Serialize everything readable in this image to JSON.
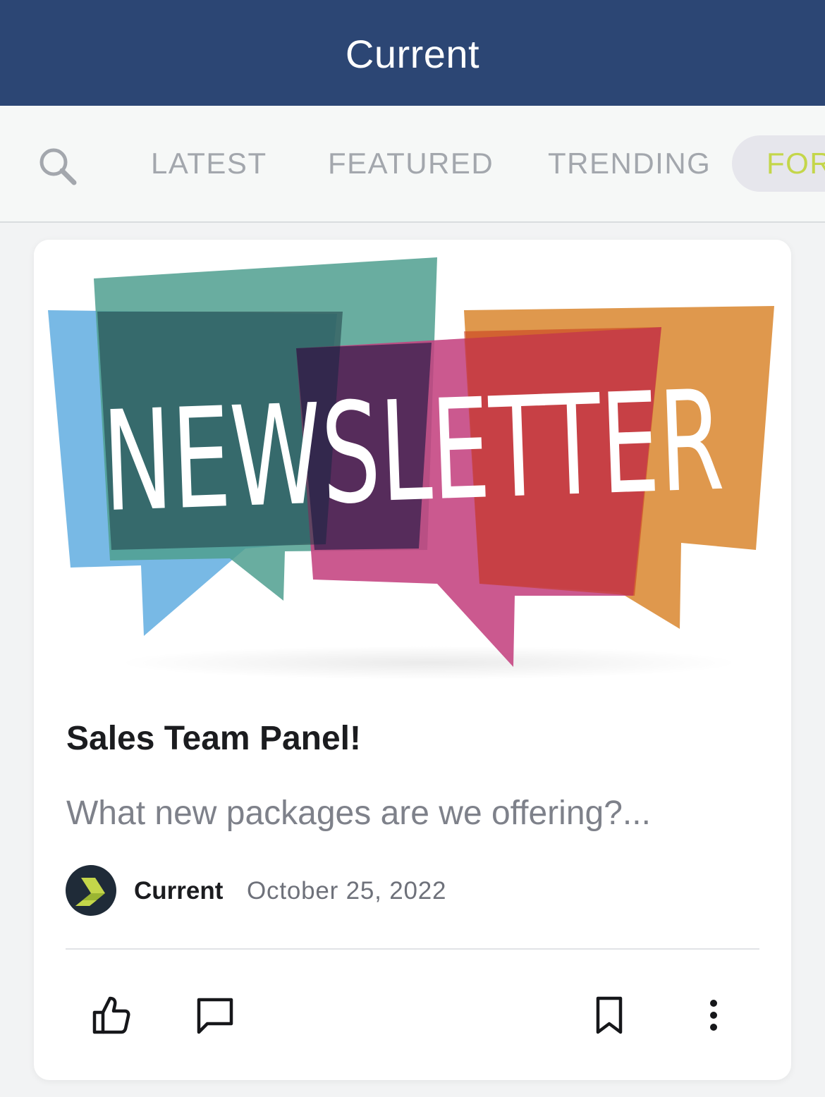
{
  "app": {
    "title": "Current"
  },
  "nav": {
    "search_icon": "search-icon",
    "tabs": [
      {
        "label": "LATEST",
        "active": false
      },
      {
        "label": "FEATURED",
        "active": false
      },
      {
        "label": "TRENDING",
        "active": false
      },
      {
        "label": "FOR",
        "active": true
      }
    ],
    "active_color": "#c4d64a",
    "inactive_color": "#a3a7ad"
  },
  "post": {
    "hero_text": "NEWSLETTER",
    "title": "Sales Team Panel!",
    "excerpt": "What new packages are we offering?...",
    "author": "Current",
    "date": "October 25, 2022",
    "actions": [
      "thumbs-up-icon",
      "comment-icon",
      "bookmark-icon",
      "more-vertical-icon"
    ]
  },
  "colors": {
    "header_bg": "#2c4674",
    "brand_green": "#c4d64a"
  }
}
